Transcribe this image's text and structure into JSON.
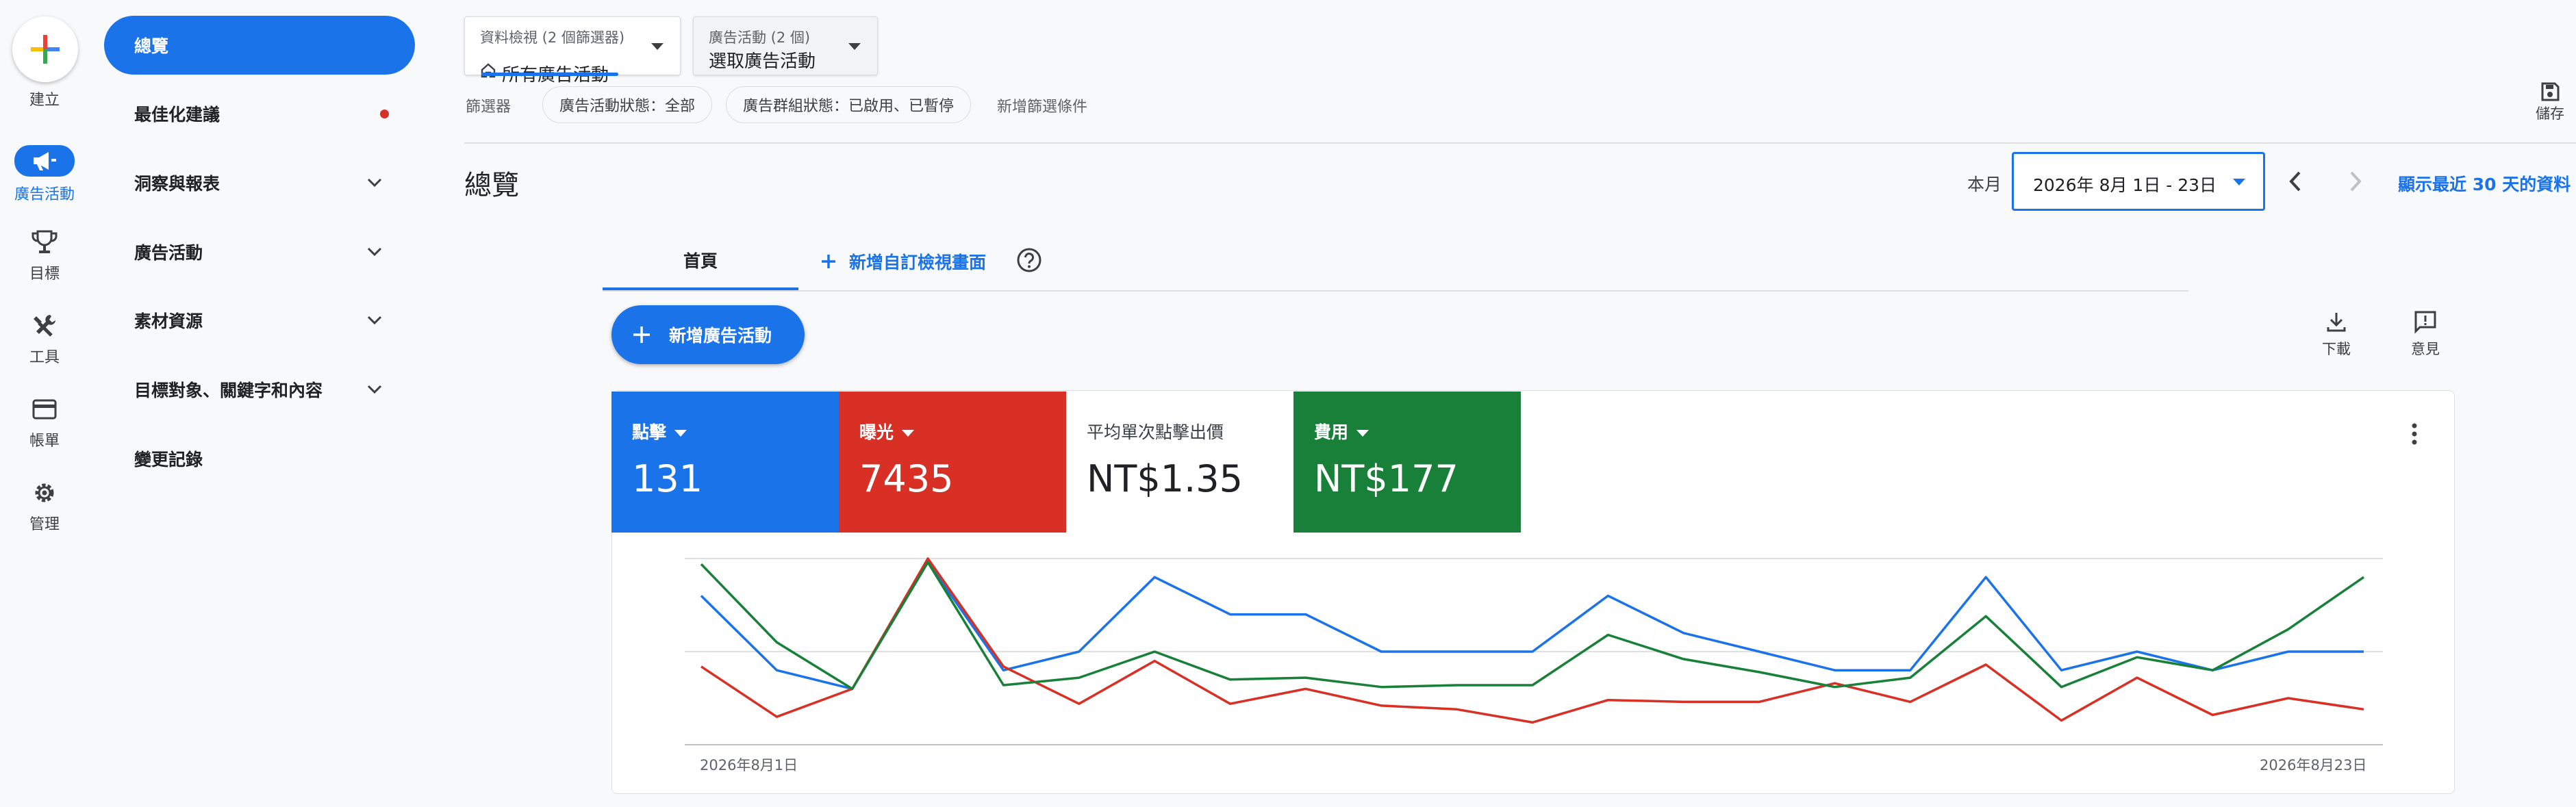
{
  "rail": {
    "create": "建立",
    "campaigns": "廣告活動",
    "goals": "目標",
    "tools": "工具",
    "billing": "帳單",
    "admin": "管理"
  },
  "nav": {
    "overview": "總覽",
    "recommendations": "最佳化建議",
    "insights": "洞察與報表",
    "campaigns": "廣告活動",
    "assets": "素材資源",
    "targeting": "目標對象、關鍵字和內容",
    "change_history": "變更記錄"
  },
  "filters": {
    "view_caption": "資料檢視 (2 個篩選器)",
    "view_value": "所有廣告活動",
    "campaign_caption": "廣告活動 (2 個)",
    "campaign_value": "選取廣告活動",
    "filter_label": "篩選器",
    "chip_campaign_status": "廣告活動狀態：全部",
    "chip_adgroup_status": "廣告群組狀態：已啟用、已暫停",
    "add_filter": "新增篩選條件"
  },
  "save_label": "儲存",
  "page_title": "總覽",
  "date": {
    "period_label": "本月",
    "range": "2026年 8月 1日 - 23日",
    "last30": "顯示最近 30 天的資料"
  },
  "tabs": {
    "home": "首頁",
    "add_view": "新增自訂檢視畫面"
  },
  "new_campaign": "新增廣告活動",
  "actions": {
    "download": "下載",
    "feedback": "意見"
  },
  "metrics": [
    {
      "label": "點擊",
      "value": "131",
      "color": "#1a73e8"
    },
    {
      "label": "曝光",
      "value": "7435",
      "color": "#d93025"
    },
    {
      "label": "平均單次點擊出價",
      "value": "NT$1.35",
      "color": "#ffffff"
    },
    {
      "label": "費用",
      "value": "NT$177",
      "color": "#188038"
    }
  ],
  "chart_data": {
    "type": "line",
    "x_start_label": "2026年8月1日",
    "x_end_label": "2026年8月23日",
    "grid": true,
    "series": [
      {
        "name": "點擊",
        "color": "#1a73e8",
        "values": [
          0.8,
          0.4,
          0.3,
          0.98,
          0.4,
          0.5,
          0.9,
          0.7,
          0.7,
          0.5,
          0.5,
          0.5,
          0.8,
          0.6,
          0.5,
          0.4,
          0.4,
          0.9,
          0.4,
          0.5,
          0.4,
          0.5,
          0.5
        ]
      },
      {
        "name": "曝光",
        "color": "#d93025",
        "values": [
          0.42,
          0.15,
          0.3,
          1.0,
          0.42,
          0.22,
          0.45,
          0.22,
          0.3,
          0.21,
          0.19,
          0.12,
          0.24,
          0.23,
          0.23,
          0.33,
          0.23,
          0.43,
          0.13,
          0.36,
          0.16,
          0.25,
          0.19
        ]
      },
      {
        "name": "費用",
        "color": "#188038",
        "values": [
          0.97,
          0.55,
          0.3,
          0.98,
          0.32,
          0.36,
          0.5,
          0.35,
          0.36,
          0.31,
          0.32,
          0.32,
          0.59,
          0.46,
          0.39,
          0.31,
          0.36,
          0.69,
          0.31,
          0.47,
          0.4,
          0.62,
          0.9
        ]
      }
    ]
  }
}
